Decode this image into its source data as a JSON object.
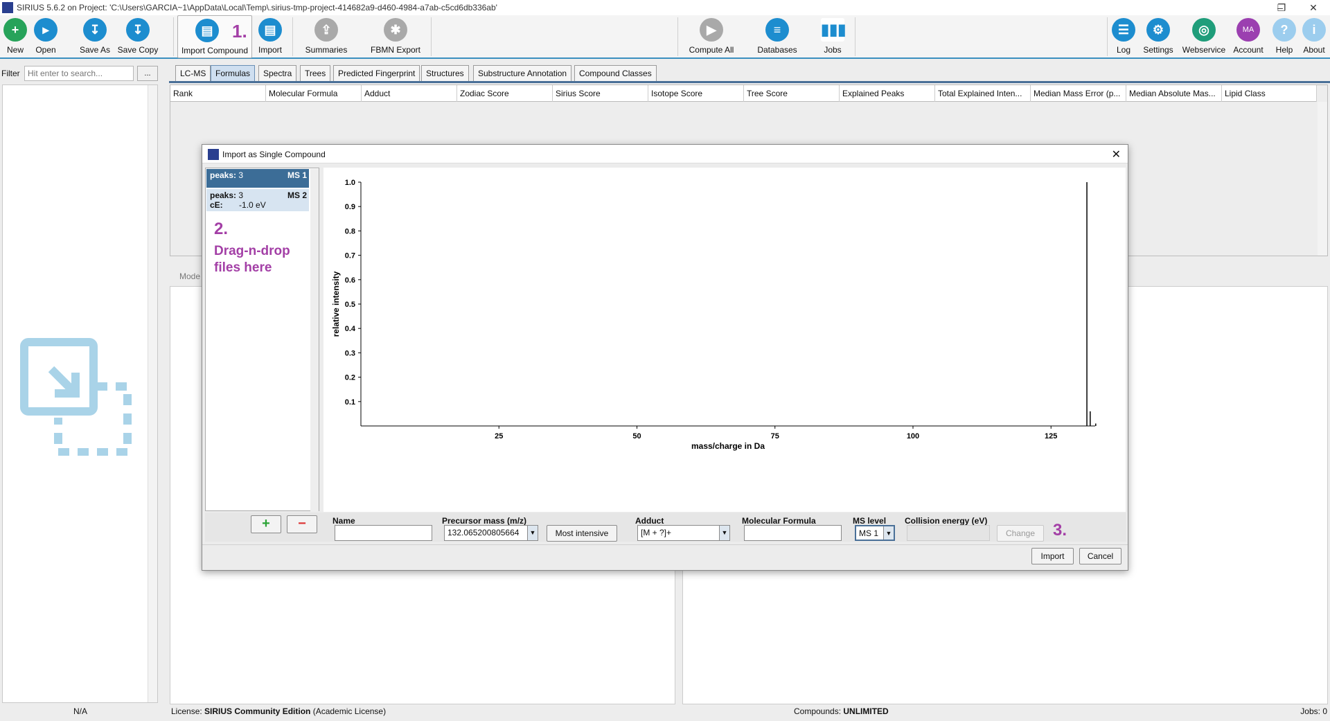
{
  "window": {
    "title": "SIRIUS 5.6.2 on Project: 'C:\\Users\\GARCIA~1\\AppData\\Local\\Temp\\.sirius-tmp-project-414682a9-d460-4984-a7ab-c5cd6db336ab'",
    "minimize": "–",
    "maximize": "❐",
    "close": "✕"
  },
  "toolbar": {
    "new": "New",
    "open": "Open",
    "save_as": "Save As",
    "save_copy": "Save Copy",
    "import_compound": "Import Compound",
    "import": "Import",
    "summaries": "Summaries",
    "fbmn_export": "FBMN Export",
    "compute_all": "Compute All",
    "databases": "Databases",
    "jobs": "Jobs",
    "log": "Log",
    "settings": "Settings",
    "webservice": "Webservice",
    "account": "Account",
    "account_initials": "MA",
    "help": "Help",
    "about": "About"
  },
  "annotations": {
    "step1": "1.",
    "step2": "2.",
    "step3": "3."
  },
  "filter": {
    "label": "Filter",
    "placeholder": "Hit enter to search...",
    "button": "..."
  },
  "tabs": [
    "LC-MS",
    "Formulas",
    "Spectra",
    "Trees",
    "Predicted Fingerprint",
    "Structures",
    "Substructure Annotation",
    "Compound Classes"
  ],
  "table": {
    "columns": [
      "Rank",
      "Molecular Formula",
      "Adduct",
      "Zodiac Score",
      "Sirius Score",
      "Isotope Score",
      "Tree Score",
      "Explained Peaks",
      "Total Explained Inten...",
      "Median Mass Error (p...",
      "Median Absolute Mas...",
      "Lipid Class"
    ]
  },
  "lower_strip_label": "Mode",
  "dialog": {
    "title": "Import as Single Compound",
    "spectra": [
      {
        "peaks_label": "peaks:",
        "peaks": "3",
        "level": "MS 1"
      },
      {
        "peaks_label": "peaks:",
        "peaks": "3",
        "level": "MS 2",
        "ce_label": "cE:",
        "ce": "-1.0 eV"
      }
    ],
    "dropzone_text_1": "Drag-n-drop",
    "dropzone_text_2": "files here",
    "form": {
      "name_label": "Name",
      "name_value": "",
      "precursor_label": "Precursor mass (m/z)",
      "precursor_value": "132.065200805664",
      "most_intensive": "Most intensive",
      "adduct_label": "Adduct",
      "adduct_value": "[M + ?]+",
      "formula_label": "Molecular Formula",
      "formula_value": "",
      "ms_level_label": "MS level",
      "ms_level_value": "MS 1",
      "collision_label": "Collision energy (eV)",
      "collision_value": "",
      "change": "Change"
    },
    "import": "Import",
    "cancel": "Cancel"
  },
  "chart_data": {
    "type": "bar",
    "xlabel": "mass/charge in Da",
    "ylabel": "relative intensity",
    "xlim": [
      0,
      133
    ],
    "ylim": [
      0,
      1.0
    ],
    "xticks": [
      25,
      50,
      75,
      100,
      125
    ],
    "yticks": [
      0.1,
      0.2,
      0.3,
      0.4,
      0.5,
      0.6,
      0.7,
      0.8,
      0.9,
      1.0
    ],
    "x": [
      131.5,
      132.1,
      133.1
    ],
    "values": [
      1.0,
      0.06,
      0.01
    ]
  },
  "status": {
    "left": "N/A",
    "license_label": "License: ",
    "license_bold": "SIRIUS Community Edition",
    "license_rest": " (Academic License)",
    "compounds_label": "Compounds: ",
    "compounds_value": "UNLIMITED",
    "jobs": "Jobs: 0"
  },
  "colors": {
    "accent": "#1d8dcf",
    "annotation": "#a33fa6",
    "selected_item": "#3c6d97"
  }
}
